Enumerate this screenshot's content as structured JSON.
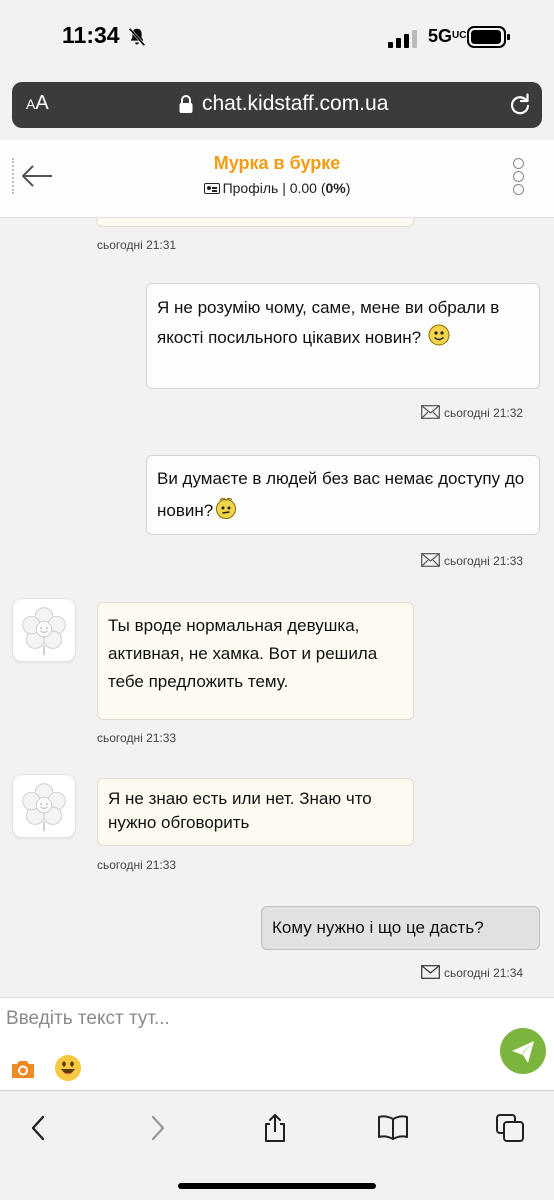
{
  "status_bar": {
    "time": "11:34",
    "network": "5G"
  },
  "browser": {
    "aa_label": "AA",
    "url": "chat.kidstaff.com.ua"
  },
  "chat": {
    "title": "Мурка в бурке",
    "profile_link": "Профіль",
    "rating_prefix": "| 0.00 (",
    "rating_percent": "0%",
    "rating_suffix": ")"
  },
  "messages": [
    {
      "direction": "in",
      "time": "сьогодні 21:31",
      "text": ""
    },
    {
      "direction": "out",
      "time": "сьогодні 21:32",
      "text": "Я не розумію чому, саме, мене ви обрали в якості посильного цікавих новин?",
      "emoji": "smile"
    },
    {
      "direction": "out",
      "time": "сьогодні 21:33",
      "text": "Ви думаєте в людей без вас немає доступу до новин?",
      "emoji": "thinking"
    },
    {
      "direction": "in",
      "time": "сьогодні 21:33",
      "text": "Ты вроде нормальная девушка, активная, не хамка. Вот и решила тебе предложить тему."
    },
    {
      "direction": "in",
      "time": "сьогодні 21:33",
      "text": "Я не знаю есть или нет. Знаю что нужно обговорить"
    },
    {
      "direction": "out",
      "time": "сьогодні 21:34",
      "text": "Кому нужно і що це дасть?"
    }
  ],
  "input": {
    "placeholder": "Введіть текст тут..."
  },
  "colors": {
    "accent": "#f39c12",
    "send": "#7cb53d",
    "incoming_bubble": "#fdfaf1"
  }
}
